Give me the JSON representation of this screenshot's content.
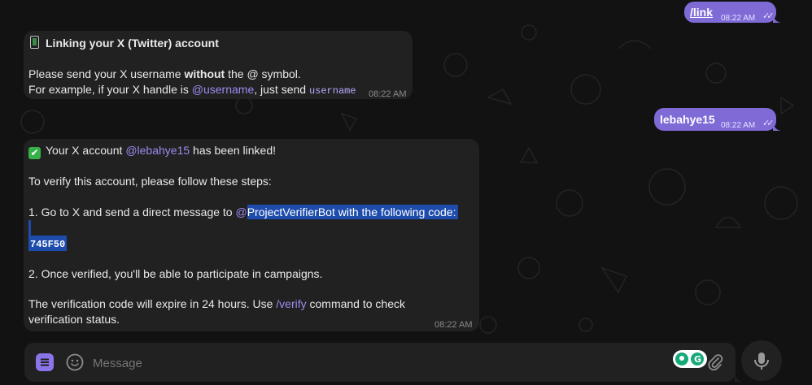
{
  "messages": {
    "out1": {
      "text": "/link",
      "time": "08:22 AM"
    },
    "bot1": {
      "title": "Linking your X (Twitter) account",
      "line1_pre": "Please send your X username ",
      "line1_bold": "without",
      "line1_post": " the @ symbol.",
      "line2_pre": "For example, if your X handle is ",
      "line2_link": "@username",
      "line2_mid": ", just send ",
      "line2_code": "username",
      "time": "08:22 AM"
    },
    "out2": {
      "text": "lebahye15",
      "time": "08:22 AM"
    },
    "bot2": {
      "line1_pre": "Your X account ",
      "line1_link": "@lebahye15",
      "line1_post": " has been linked!",
      "line2": "To verify this account, please follow these steps:",
      "step1_pre": "1. Go to X and send a direct message to ",
      "step1_at": "@",
      "step1_sel": "ProjectVerifierBot with the following code:",
      "code": "745F50",
      "step2": "2. Once verified, you'll be able to participate in campaigns.",
      "exp_pre": "The verification code will expire in 24 hours. Use ",
      "exp_link": "/verify",
      "exp_post": " command to check",
      "exp_line2": "verification status.",
      "time": "08:22 AM"
    }
  },
  "composer": {
    "placeholder": "Message"
  },
  "colors": {
    "accent": "#7f6ad6",
    "selection": "#1d4cad",
    "bubble_in": "#212121",
    "background": "#121212"
  },
  "icons": [
    "menu-icon",
    "emoji-icon",
    "grammarly-icon",
    "attach-icon",
    "mic-icon",
    "double-check-icon",
    "phone-icon",
    "check-mark-icon"
  ]
}
